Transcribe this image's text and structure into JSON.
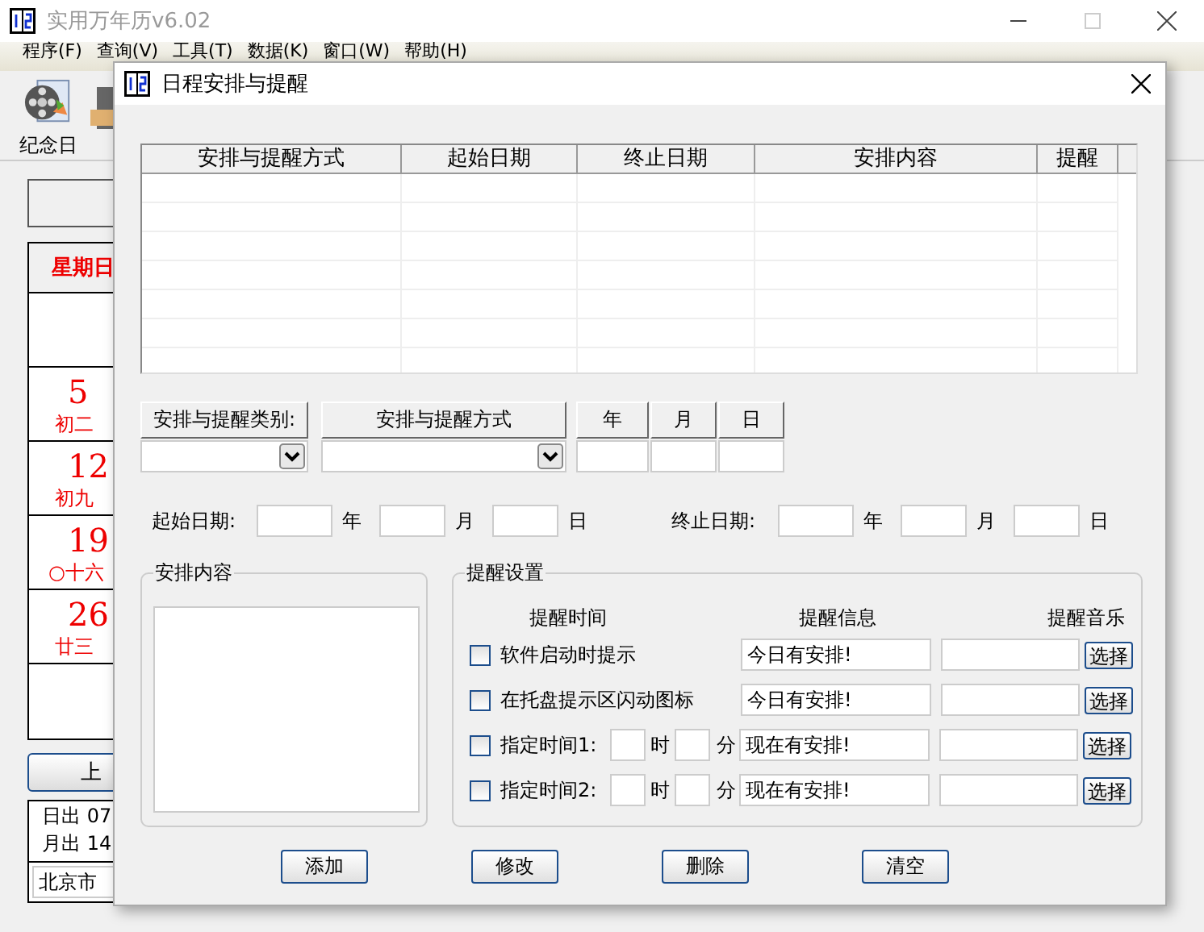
{
  "window": {
    "title": "实用万年历v6.02"
  },
  "menu": [
    {
      "label": "程序(F)"
    },
    {
      "label": "查询(V)"
    },
    {
      "label": "工具(T)"
    },
    {
      "label": "数据(K)"
    },
    {
      "label": "窗口(W)"
    },
    {
      "label": "帮助(H)"
    }
  ],
  "toolbar": [
    {
      "label": "纪念日"
    }
  ],
  "calendar": {
    "weekday": "星期日",
    "cells": [
      {
        "kind": "empty"
      },
      {
        "kind": "date",
        "day": "5",
        "lunar": "初二"
      },
      {
        "kind": "date",
        "day": "12",
        "lunar": "初九"
      },
      {
        "kind": "date",
        "day": "19",
        "lunar": "○十六"
      },
      {
        "kind": "date",
        "day": "26",
        "lunar": "廿三"
      },
      {
        "kind": "empty"
      }
    ]
  },
  "prev_button": "上",
  "sun_moon": [
    "日出 07",
    "月出 14"
  ],
  "city": "北京市",
  "dialog": {
    "title": "日程安排与提醒",
    "table": {
      "columns": [
        "安排与提醒方式",
        "起始日期",
        "终止日期",
        "安排内容",
        "提醒"
      ]
    },
    "category_button": "安排与提醒类别:",
    "method_button": "安排与提醒方式",
    "date_buttons": [
      "年",
      "月",
      "日"
    ],
    "date_ranges": [
      {
        "label": "起始日期:",
        "units": [
          "年",
          "月",
          "日"
        ]
      },
      {
        "label": "终止日期:",
        "units": [
          "年",
          "月",
          "日"
        ]
      }
    ],
    "content_group": {
      "title": "安排内容"
    },
    "reminder_group": {
      "title": "提醒设置",
      "headers": [
        "提醒时间",
        "提醒信息",
        "提醒音乐"
      ],
      "rows": [
        {
          "kind": "option",
          "checked": false,
          "label": "软件启动时提示",
          "message": "今日有安排!",
          "choose": "选择"
        },
        {
          "kind": "option",
          "checked": false,
          "label": "在托盘提示区闪动图标",
          "message": "今日有安排!",
          "choose": "选择"
        },
        {
          "kind": "time",
          "checked": false,
          "label": "指定时间1:",
          "hour_unit": "时",
          "minute_unit": "分",
          "message": "现在有安排!",
          "choose": "选择"
        },
        {
          "kind": "time",
          "checked": false,
          "label": "指定时间2:",
          "hour_unit": "时",
          "minute_unit": "分",
          "message": "现在有安排!",
          "choose": "选择"
        }
      ]
    },
    "buttons": [
      "添加",
      "修改",
      "删除",
      "清空"
    ]
  }
}
